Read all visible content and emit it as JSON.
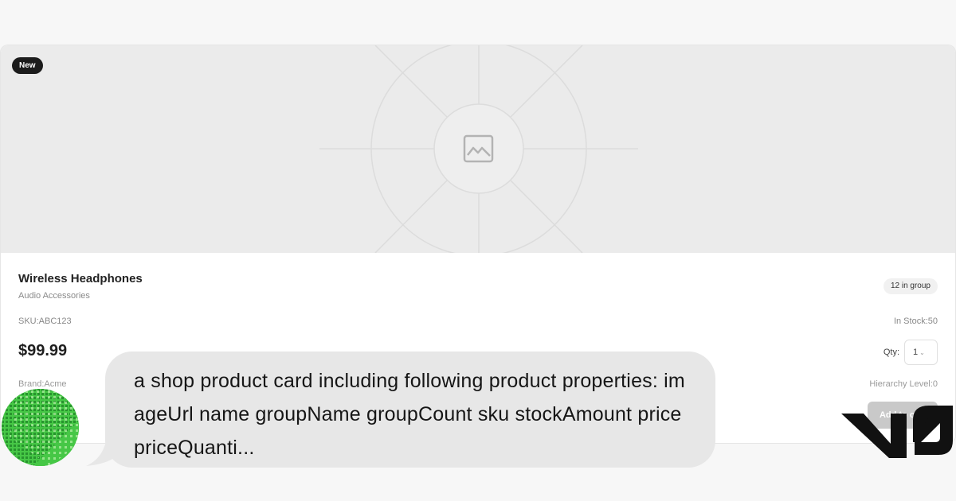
{
  "product": {
    "badge": "New",
    "name": "Wireless Headphones",
    "group_name": "Audio Accessories",
    "group_count": "12 in group",
    "sku": "SKU:ABC123",
    "stock": "In Stock:50",
    "price": "$99.99",
    "qty_label": "Qty:",
    "qty_value": "1",
    "brand": "Brand:Acme",
    "hierarchy": "Hierarchy Level:0",
    "add_to_cart": "Add to cart"
  },
  "chat": {
    "message": "a shop product card including following product properties: imageUrl name groupName groupCount sku stockAmount price priceQuanti..."
  },
  "icons": {
    "image_placeholder": "image-icon",
    "logo": "v0-logo"
  },
  "colors": {
    "accent": "#1c1c1c",
    "avatar_green": "#3fbf3f",
    "bubble_bg": "#e7e7e7"
  }
}
